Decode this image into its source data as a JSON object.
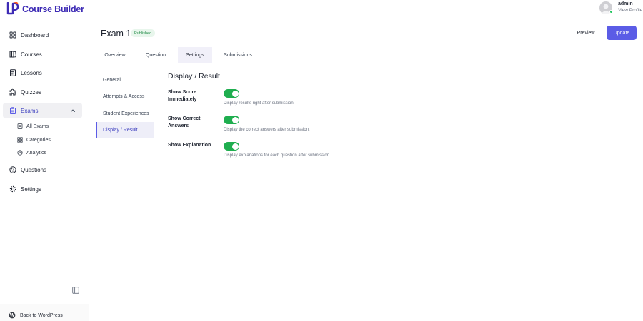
{
  "brand": {
    "name": "Course Builder",
    "color": "#3d2bb5"
  },
  "user": {
    "name": "admin",
    "profile_link": "View Profile",
    "status_color": "#22c55e"
  },
  "sidebar": {
    "items": [
      {
        "label": "Dashboard",
        "icon": "dashboard-grid-icon"
      },
      {
        "label": "Courses",
        "icon": "courses-book-icon"
      },
      {
        "label": "Lessons",
        "icon": "lessons-document-icon"
      },
      {
        "label": "Quizzes",
        "icon": "quizzes-puzzle-icon"
      },
      {
        "label": "Exams",
        "icon": "exams-clipboard-icon",
        "expanded": true
      },
      {
        "label": "Questions",
        "icon": "questions-help-icon"
      },
      {
        "label": "Settings",
        "icon": "settings-gear-icon"
      }
    ],
    "exam_subitems": [
      {
        "label": "All Exams",
        "icon": "list-icon"
      },
      {
        "label": "Categories",
        "icon": "categories-grid-icon"
      },
      {
        "label": "Analytics",
        "icon": "analytics-pie-icon"
      }
    ],
    "footer": {
      "label": "Back to WordPress",
      "icon": "wordpress-icon"
    }
  },
  "header": {
    "title": "Exam 1",
    "status": "Published",
    "preview_label": "Preview",
    "update_label": "Update",
    "accent": "#5b5ce6"
  },
  "tabs": [
    {
      "label": "Overview"
    },
    {
      "label": "Question"
    },
    {
      "label": "Settings",
      "active": true
    },
    {
      "label": "Submissions"
    }
  ],
  "settings_nav": [
    {
      "label": "General"
    },
    {
      "label": "Attempts & Access"
    },
    {
      "label": "Student Experiences"
    },
    {
      "label": "Display / Result",
      "active": true
    }
  ],
  "display_result": {
    "title": "Display / Result",
    "toggle_color": "#1fae4f",
    "fields": [
      {
        "label": "Show Score Immediately",
        "enabled": true,
        "help": "Display results right after submission."
      },
      {
        "label": "Show Correct Answers",
        "enabled": true,
        "help": "Display the correct answers after submission."
      },
      {
        "label": "Show Explanation",
        "enabled": true,
        "help": "Display explanations for each question after submission."
      }
    ]
  }
}
